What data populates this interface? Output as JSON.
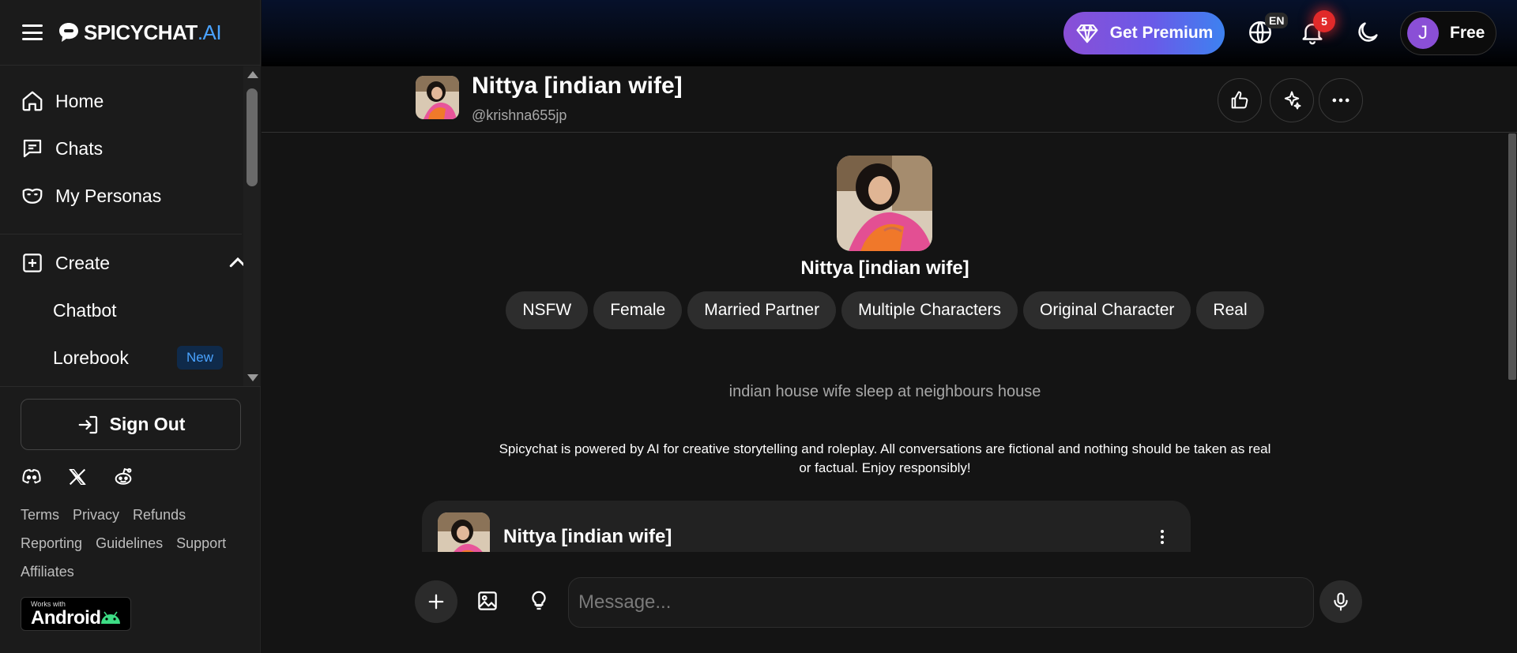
{
  "brand": {
    "name": "SPICYCHAT",
    "suffix": ".AI"
  },
  "sidebar": {
    "nav": [
      {
        "label": "Home",
        "icon": "home-icon"
      },
      {
        "label": "Chats",
        "icon": "chat-icon"
      },
      {
        "label": "My Personas",
        "icon": "mask-icon"
      }
    ],
    "create": {
      "label": "Create",
      "icon": "plus-square-icon"
    },
    "create_items": [
      {
        "label": "Chatbot"
      },
      {
        "label": "Lorebook",
        "badge": "New"
      }
    ],
    "sign_out": "Sign Out",
    "socials": [
      "discord-icon",
      "x-icon",
      "reddit-icon"
    ],
    "links": [
      "Terms",
      "Privacy",
      "Refunds",
      "Reporting",
      "Guidelines",
      "Support",
      "Affiliates"
    ],
    "android_badge": {
      "small": "Works with",
      "big": "Android"
    }
  },
  "topbar": {
    "premium_label": "Get Premium",
    "language": "EN",
    "notification_count": "5",
    "user_initial": "J",
    "plan": "Free"
  },
  "chat_header": {
    "name": "Nittya [indian wife]",
    "handle": "@krishna655jp"
  },
  "profile": {
    "name": "Nittya [indian wife]",
    "tags": [
      "NSFW",
      "Female",
      "Married Partner",
      "Multiple Characters",
      "Original Character",
      "Real"
    ],
    "description": "indian house wife sleep at neighbours house",
    "disclaimer": "Spicychat is powered by AI for creative storytelling and roleplay. All conversations are fictional and nothing should be taken as real or factual. Enjoy responsibly!"
  },
  "message": {
    "name": "Nittya [indian wife]"
  },
  "composer": {
    "placeholder": "Message..."
  },
  "colors": {
    "accent_blue": "#4aa3ff",
    "premium_start": "#8a4fd6",
    "premium_end": "#3d82f0",
    "notification": "#e12a2a"
  }
}
